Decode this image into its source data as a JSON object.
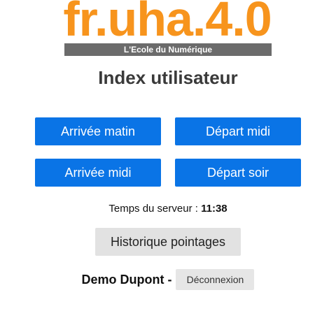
{
  "logo": {
    "text": "fr.uha.4.0",
    "tagline": "L'Ecole du Numérique",
    "accent": "#f7941d",
    "bar_color": "#6b6b6b"
  },
  "page": {
    "title": "Index utilisateur"
  },
  "actions": {
    "arrivee_matin": "Arrivée matin",
    "depart_midi": "Départ midi",
    "arrivee_midi": "Arrivée midi",
    "depart_soir": "Départ soir",
    "button_color": "#0a74e6"
  },
  "server": {
    "label": "Temps du serveur :",
    "time": "11:38"
  },
  "history": {
    "label": "Historique pointages"
  },
  "user": {
    "name": "Demo Dupont -",
    "logout_label": "Déconnexion"
  }
}
